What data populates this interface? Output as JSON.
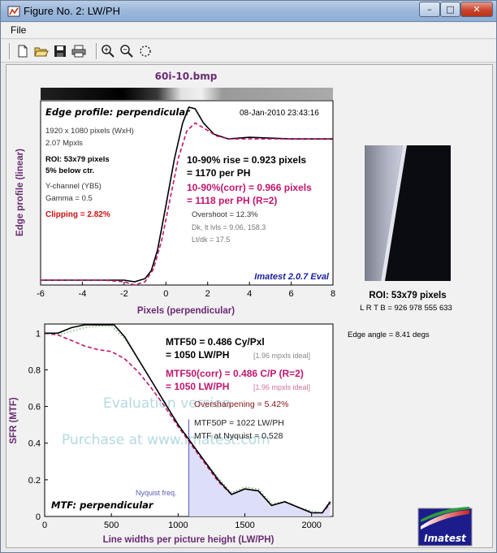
{
  "window": {
    "title": "Figure No. 2: LW/PH",
    "minimize": "–",
    "maximize": "□",
    "close": "✕"
  },
  "menu": {
    "file": "File"
  },
  "toolbar": {
    "icons": [
      "new-file-icon",
      "open-folder-icon",
      "save-icon",
      "print-icon",
      "zoom-in-icon",
      "zoom-out-icon",
      "rotate-icon"
    ]
  },
  "figure": {
    "title": "60i-10.bmp",
    "top_panel": {
      "heading": "Edge profile: perpendicular",
      "timestamp": "08-Jan-2010 23:43:16",
      "info": [
        "1920 x 1080 pixels (WxH)",
        "2.07 Mpxls"
      ],
      "roi": [
        "ROI: 53x79 pixels",
        "5% below ctr."
      ],
      "channel": [
        "Y-channel  (YB5)",
        "Gamma = 0.5"
      ],
      "clipping": "Clipping =   2.82%",
      "rise": [
        "10-90% rise = 0.923 pixels",
        "= 1170 per PH"
      ],
      "rise_corr": [
        "10-90%(corr) = 0.966 pixels",
        "= 1118 per PH  (R=2)"
      ],
      "overshoot": "Overshoot = 12.3%",
      "dk": [
        "Dk, lt lvls = 9.06, 158.3",
        "Lt/dk = 17.5"
      ],
      "brand": "Imatest 2.0.7 Eval",
      "ylabel": "Edge profile (linear)",
      "xlabel": "Pixels (perpendicular)"
    },
    "side": {
      "roi_label": "ROI: 53x79 pixels",
      "lrtb": "L R  T B = 926 978   555 633",
      "edge_angle": "Edge angle = 8.41 degs"
    },
    "bottom_panel": {
      "mtf50": [
        "MTF50 = 0.486 Cy/Pxl",
        "= 1050 LW/PH"
      ],
      "ideal": "[1.96 mpxls ideal]",
      "mtf50_corr": [
        "MTF50(corr) = 0.486 C/P  (R=2)",
        "= 1050 LW/PH"
      ],
      "oversharp": "Oversharpening = 5.42%",
      "mtf50p": [
        "MTF50P = 1022 LW/PH",
        "MTF at Nyquist = 0.528"
      ],
      "nyquist": "Nyquist freq.",
      "heading": "MTF: perpendicular",
      "watermark": [
        "Evaluation version",
        "Purchase at www.imatest.com"
      ],
      "ylabel": "SFR (MTF)",
      "xlabel": "Line widths per picture height (LW/PH)"
    },
    "logo_text": "Imatest"
  },
  "chart_data": [
    {
      "type": "line",
      "title": "Edge profile: perpendicular",
      "xlabel": "Pixels (perpendicular)",
      "ylabel": "Edge profile (linear)",
      "xlim": [
        -6,
        8
      ],
      "xticks": [
        -6,
        -4,
        -2,
        0,
        2,
        4,
        6,
        8
      ],
      "ylim": [
        0,
        1.1
      ],
      "grid": false,
      "series": [
        {
          "color": "#000000",
          "style": "solid",
          "x": [
            -6,
            -3,
            -2,
            -1.5,
            -1,
            -0.7,
            -0.4,
            0,
            0.4,
            0.8,
            1.1,
            1.4,
            1.8,
            2.3,
            3,
            4,
            6,
            8
          ],
          "y": [
            0.01,
            0.01,
            0.01,
            0.0,
            0.02,
            0.07,
            0.2,
            0.48,
            0.77,
            1.0,
            1.1,
            1.09,
            1.0,
            0.93,
            0.9,
            0.91,
            0.9,
            0.9
          ]
        },
        {
          "color": "#c0166e",
          "style": "dashed",
          "x": [
            -6,
            -3,
            -2,
            -1.5,
            -1,
            -0.6,
            -0.2,
            0.2,
            0.6,
            1,
            1.4,
            1.8,
            2.4,
            3,
            4,
            6,
            8
          ],
          "y": [
            0.01,
            0.01,
            0.0,
            -0.02,
            0.0,
            0.08,
            0.26,
            0.52,
            0.78,
            0.95,
            1.0,
            0.97,
            0.92,
            0.9,
            0.9,
            0.9,
            0.9
          ]
        }
      ]
    },
    {
      "type": "line",
      "title": "MTF: perpendicular",
      "xlabel": "Line widths per picture height (LW/PH)",
      "ylabel": "SFR (MTF)",
      "xlim": [
        0,
        2160
      ],
      "xticks": [
        0,
        500,
        1000,
        1500,
        2000
      ],
      "ylim": [
        0,
        1.05
      ],
      "yticks": [
        0,
        0.2,
        0.4,
        0.6,
        0.8,
        1
      ],
      "nyquist": 1080,
      "series": [
        {
          "color": "#000000",
          "style": "solid",
          "x": [
            0,
            100,
            200,
            300,
            400,
            460,
            520,
            600,
            700,
            800,
            900,
            1000,
            1100,
            1200,
            1300,
            1400,
            1500,
            1600,
            1700,
            1800,
            1900,
            2000,
            2080,
            2140
          ],
          "y": [
            1.0,
            1.0,
            1.03,
            1.05,
            1.06,
            1.07,
            1.06,
            0.98,
            0.86,
            0.74,
            0.62,
            0.5,
            0.4,
            0.3,
            0.2,
            0.12,
            0.15,
            0.14,
            0.06,
            0.08,
            0.05,
            0.02,
            0.02,
            0.08
          ]
        },
        {
          "color": "#c0166e",
          "style": "dashed",
          "x": [
            0,
            100,
            200,
            300,
            400,
            500,
            600,
            700,
            800,
            900,
            1000,
            1100,
            1200,
            1300,
            1400,
            1500,
            1600,
            1700,
            1800,
            1900,
            2000,
            2080,
            2140
          ],
          "y": [
            1.0,
            0.99,
            0.96,
            0.93,
            0.91,
            0.9,
            0.86,
            0.79,
            0.7,
            0.6,
            0.49,
            0.39,
            0.29,
            0.19,
            0.12,
            0.15,
            0.14,
            0.06,
            0.08,
            0.05,
            0.02,
            0.02,
            0.07
          ]
        },
        {
          "color": "#55aa55",
          "style": "dotted",
          "x": [
            0,
            100,
            200,
            300,
            400,
            500,
            600,
            700,
            800,
            900,
            1000,
            1100,
            1200,
            1300,
            1400,
            1500,
            1600,
            1700,
            1800,
            1900,
            2000,
            2080,
            2140
          ],
          "y": [
            1.0,
            0.99,
            1.01,
            1.03,
            1.04,
            1.04,
            0.97,
            0.86,
            0.74,
            0.62,
            0.5,
            0.4,
            0.3,
            0.21,
            0.13,
            0.16,
            0.15,
            0.07,
            0.08,
            0.05,
            0.03,
            0.02,
            0.09
          ]
        }
      ]
    }
  ]
}
